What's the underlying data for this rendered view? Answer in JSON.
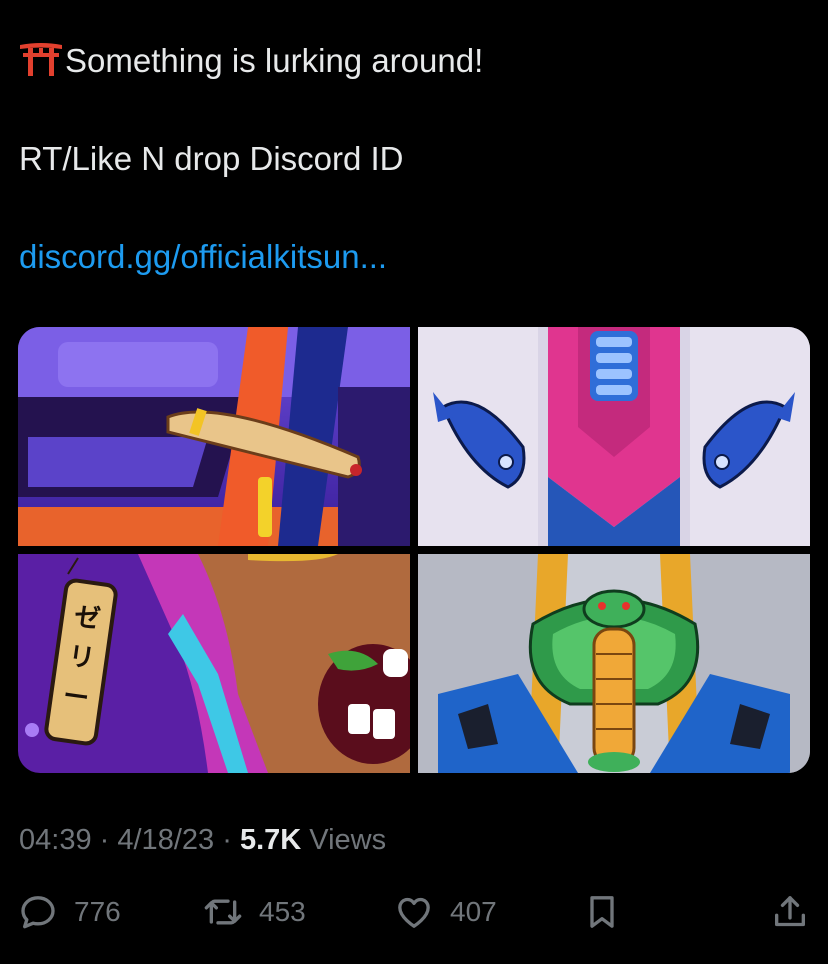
{
  "tweet": {
    "line1": "Something is lurking around!",
    "line2": "RT/Like N drop Discord ID",
    "link": "discord.gg/officialkitsun...",
    "leading_icon": "torii-gate-icon",
    "images": [
      {
        "name": "cigar-artwork",
        "sign_text": ""
      },
      {
        "name": "fish-mech-artwork",
        "sign_text": ""
      },
      {
        "name": "tag-mouth-artwork",
        "sign_text": "ゼリー"
      },
      {
        "name": "cobra-mech-artwork",
        "sign_text": ""
      }
    ]
  },
  "meta": {
    "time": "04:39",
    "sep1": "·",
    "date": "4/18/23",
    "sep2": "·",
    "views_count": "5.7K",
    "views_label": "Views"
  },
  "actions": {
    "replies": "776",
    "retweets": "453",
    "likes": "407"
  },
  "colors": {
    "background": "#000000",
    "text": "#e7e9ea",
    "muted": "#71767b",
    "link": "#1d9bf0"
  }
}
